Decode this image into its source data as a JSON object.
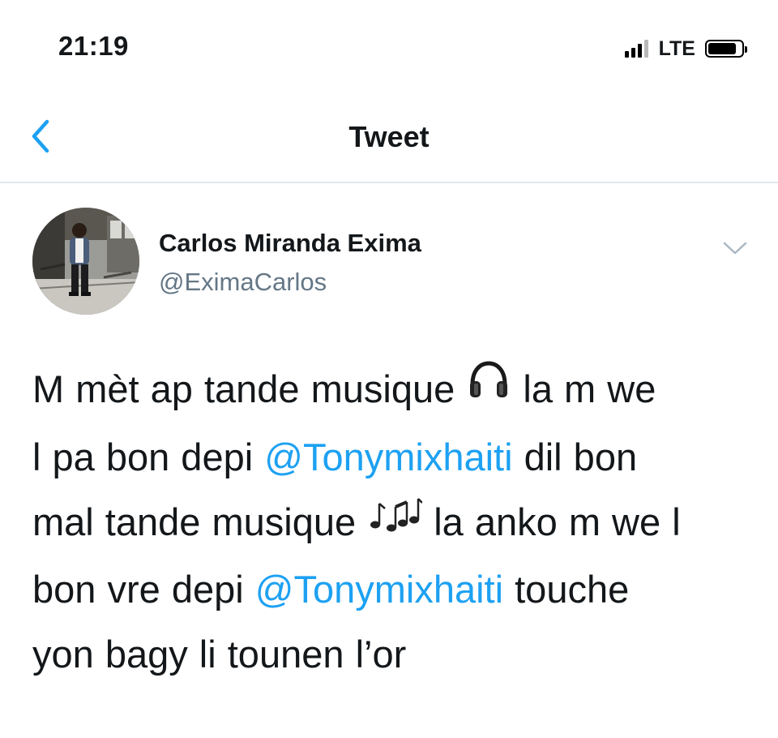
{
  "status_bar": {
    "time": "21:19",
    "network": "LTE",
    "battery_level": 0.85,
    "signal_bars": 3
  },
  "nav": {
    "title": "Tweet",
    "back_icon": "chevron-left-icon",
    "accent_color": "#1da1f2"
  },
  "tweet": {
    "author_name": "Carlos Miranda Exima",
    "author_handle": "@EximaCarlos",
    "menu_icon": "chevron-down-icon",
    "lines": [
      [
        {
          "text": "M mèt ap tande musique "
        },
        {
          "emoji": "headphones-icon"
        },
        {
          "text": " la m we"
        }
      ],
      [
        {
          "text": "l pa bon depi "
        },
        {
          "mention": "@Tonymixhaiti"
        },
        {
          "text": " dil bon"
        }
      ],
      [
        {
          "text": "mal tande musique "
        },
        {
          "emoji": "musical-notes-icon"
        },
        {
          "text": " la anko m we l"
        }
      ],
      [
        {
          "text": "bon vre depi "
        },
        {
          "mention": "@Tonymixhaiti"
        },
        {
          "text": " touche"
        }
      ],
      [
        {
          "text": "yon bagy li tounen l’or"
        }
      ]
    ]
  },
  "colors": {
    "text": "#14171a",
    "secondary": "#657786",
    "mention": "#1da1f2",
    "divider": "#e1e8ed"
  }
}
